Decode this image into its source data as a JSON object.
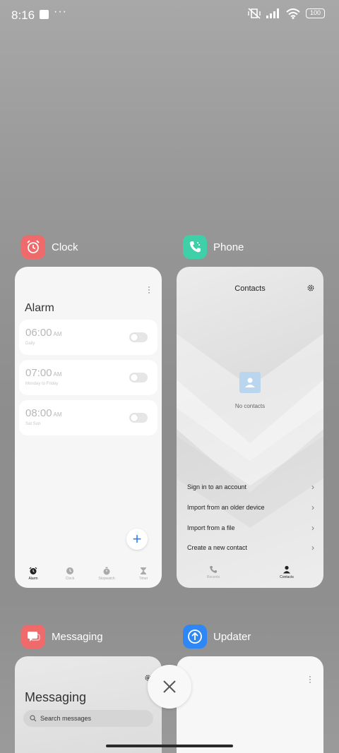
{
  "status_bar": {
    "time": "8:16",
    "dots": "···",
    "battery": "100"
  },
  "apps": {
    "clock": {
      "name": "Clock",
      "icon": "alarm-clock-icon",
      "color": "#ef6a6a"
    },
    "phone": {
      "name": "Phone",
      "icon": "phone-icon",
      "color": "#3fcfa9"
    },
    "messaging": {
      "name": "Messaging",
      "icon": "chat-bubble-icon",
      "color": "#ef6a6a"
    },
    "updater": {
      "name": "Updater",
      "icon": "arrow-up-icon",
      "color": "#2f86f5"
    }
  },
  "clock_card": {
    "title": "Alarm",
    "alarms": [
      {
        "time": "06:00",
        "ampm": "AM",
        "repeat": "Daily",
        "enabled": false
      },
      {
        "time": "07:00",
        "ampm": "AM",
        "repeat": "Monday to Friday",
        "enabled": false
      },
      {
        "time": "08:00",
        "ampm": "AM",
        "repeat": "Sat Sun",
        "enabled": false
      }
    ],
    "nav": [
      "Alarm",
      "Clock",
      "Stopwatch",
      "Timer"
    ],
    "active_nav": "Alarm"
  },
  "phone_card": {
    "title": "Contacts",
    "empty_text": "No contacts",
    "menu": [
      "Sign in to an account",
      "Import from an older device",
      "Import from a file",
      "Create a new contact"
    ],
    "nav": [
      "Recents",
      "Contacts"
    ],
    "active_nav": "Contacts"
  },
  "messaging_card": {
    "title": "Messaging",
    "search_placeholder": "Search messages"
  }
}
